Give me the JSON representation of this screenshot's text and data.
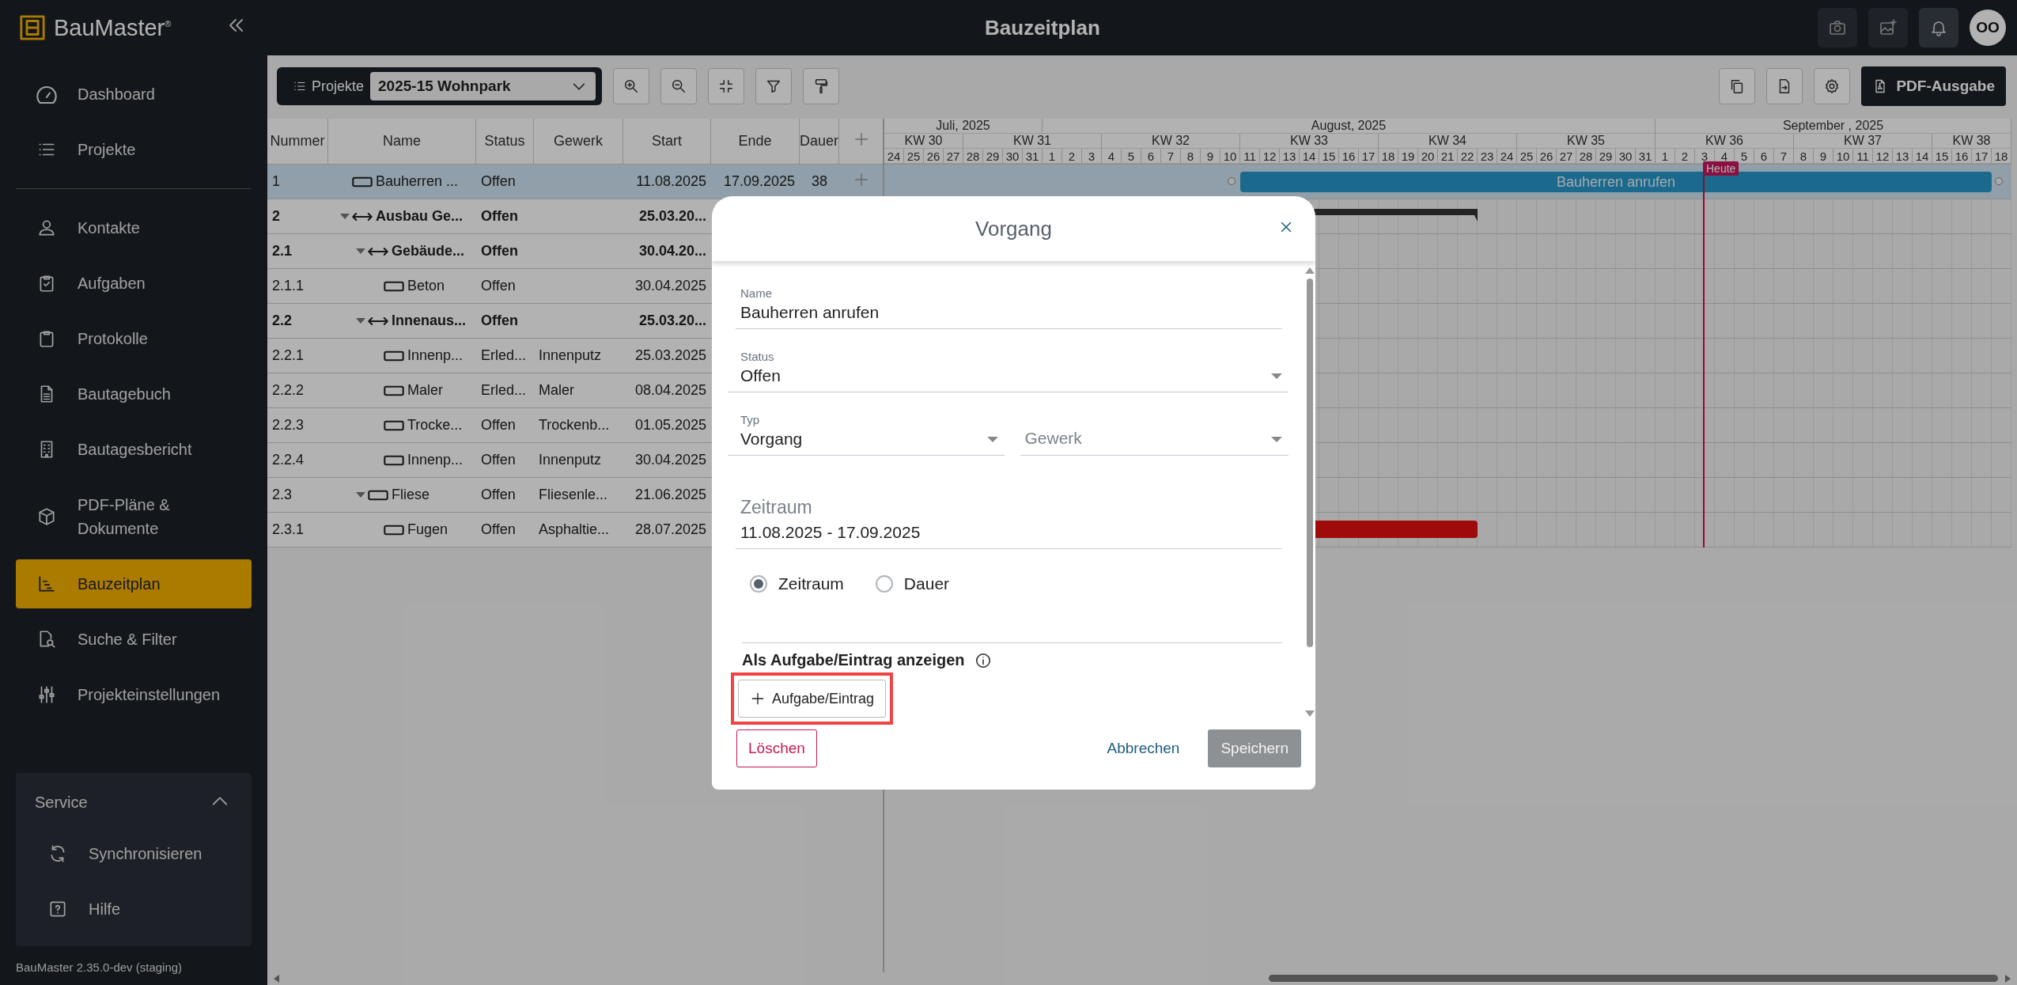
{
  "app": {
    "logo": "BauMaster$^{®}$",
    "version": "BauMaster 2.35.0-dev (staging)"
  },
  "top_bar": {
    "title": "Bauzeitplan",
    "avatar": "OO"
  },
  "sidebar": {
    "sections": [
      {
        "items": [
          {
            "label": "Dashboard",
            "selected": false
          },
          {
            "label": "Projekte",
            "selected": false
          }
        ]
      },
      {
        "items": [
          {
            "label": "Kontakte",
            "selected": false
          },
          {
            "label": "Aufgaben",
            "selected": false
          },
          {
            "label": "Protokolle",
            "selected": false
          },
          {
            "label": "Bautagebuch",
            "selected": false
          },
          {
            "label": "Bautagesbericht",
            "selected": false
          },
          {
            "label": "PDF-Pläne & Dokumente",
            "selected": false
          },
          {
            "label": "Bauzeitplan",
            "selected": true
          },
          {
            "label": "Suche & Filter",
            "selected": false
          },
          {
            "label": "Projekteinstellungen",
            "selected": false
          }
        ]
      }
    ],
    "service": {
      "title": "Service",
      "expanded": true,
      "items": [
        "Synchronisieren",
        "Hilfe"
      ]
    }
  },
  "toolbar": {
    "project_label": "Projekte",
    "project": "2025-15 Wohnpark",
    "export_button": "PDF-Ausgabe"
  },
  "table": {
    "columns": [
      "Nummer",
      "Name",
      "Status",
      "Gewerk",
      "Start",
      "Ende",
      "Dauer"
    ],
    "rows": [
      {
        "number": "1",
        "kind": "task",
        "name": "Bauherren ...",
        "status": "Offen",
        "start": "11.08.2025",
        "end": "17.09.2025",
        "duration": "38",
        "selected": true,
        "bar": {
          "kind": "task",
          "label": "Bauherren anrufen"
        }
      },
      {
        "number": "2",
        "kind": "summary",
        "name": "Ausbau Ge...",
        "status": "Offen",
        "start": "25.03.20...",
        "selected": false,
        "expanded": true,
        "bar": {
          "kind": "summary"
        },
        "children": [
          {
            "number": "2.1",
            "kind": "summary",
            "name": "Gebäude...",
            "status": "Offen",
            "start": "30.04.20...",
            "selected": false,
            "expanded": true,
            "children": [
              {
                "number": "2.1.1",
                "kind": "task",
                "name": "Beton",
                "status": "Offen",
                "start": "30.04.2025",
                "selected": false
              }
            ]
          },
          {
            "number": "2.2",
            "kind": "summary",
            "name": "Innenaus...",
            "status": "Offen",
            "start": "25.03.20...",
            "selected": false,
            "expanded": true,
            "children": [
              {
                "number": "2.2.1",
                "kind": "task",
                "name": "Innenp...",
                "status": "Erled...",
                "trade": "Innenputz",
                "start": "25.03.2025",
                "selected": false
              },
              {
                "number": "2.2.2",
                "kind": "task",
                "name": "Maler",
                "status": "Erled...",
                "trade": "Maler",
                "start": "08.04.2025",
                "selected": false
              },
              {
                "number": "2.2.3",
                "kind": "task",
                "name": "Trocke...",
                "status": "Offen",
                "trade": "Trockenb...",
                "start": "01.05.2025",
                "selected": false
              },
              {
                "number": "2.2.4",
                "kind": "task",
                "name": "Innenp...",
                "status": "Offen",
                "trade": "Innenputz",
                "start": "30.04.2025",
                "selected": false
              }
            ]
          },
          {
            "number": "2.3",
            "kind": "task",
            "name": "Fliese",
            "status": "Offen",
            "trade": "Fliesenle...",
            "start": "21.06.2025",
            "selected": false,
            "expanded": true,
            "children": [
              {
                "number": "2.3.1",
                "kind": "task",
                "name": "Fugen",
                "status": "Offen",
                "trade": "Asphaltie...",
                "start": "28.07.2025",
                "selected": false,
                "bar": {
                  "kind": "critical"
                }
              }
            ]
          }
        ]
      }
    ]
  },
  "gantt": {
    "today_label": "Heute",
    "months": [
      {
        "label": "Juli, 2025",
        "days": [
          "24",
          "25",
          "26",
          "27",
          "28",
          "29",
          "30",
          "31"
        ]
      },
      {
        "label": "August, 2025",
        "days": [
          "1",
          "2",
          "3",
          "4",
          "5",
          "6",
          "7",
          "8",
          "9",
          "10",
          "11",
          "12",
          "13",
          "14",
          "15",
          "16",
          "17",
          "18",
          "19",
          "20",
          "21",
          "22",
          "23",
          "24",
          "25",
          "26",
          "27",
          "28",
          "29",
          "30",
          "31"
        ]
      },
      {
        "label": "September , 2025",
        "days": [
          "1",
          "2",
          "3",
          "4",
          "5",
          "6",
          "7",
          "8",
          "9",
          "10",
          "11",
          "12",
          "13",
          "14",
          "15",
          "16",
          "17",
          "18"
        ]
      }
    ],
    "weeks": [
      "KW 30",
      "KW 31",
      "KW 32",
      "KW 33",
      "KW 34",
      "KW 35",
      "KW 36",
      "KW 37",
      "KW 38"
    ]
  },
  "dialog": {
    "title": "Vorgang",
    "name": {
      "label": "Name",
      "value": "Bauherren anrufen"
    },
    "status": {
      "label": "Status",
      "value": "Offen"
    },
    "type": {
      "label": "Typ",
      "value": "Vorgang"
    },
    "trade": {
      "placeholder": "Gewerk"
    },
    "period": {
      "label": "Zeitraum",
      "value": "11.08.2025 - 17.09.2025"
    },
    "mode_options": [
      {
        "label": "Zeitraum",
        "selected": true
      },
      {
        "label": "Dauer",
        "selected": false
      }
    ],
    "task_section": {
      "heading": "Als Aufgabe/Eintrag anzeigen",
      "button": "Aufgabe/Eintrag",
      "highlighted": true
    },
    "delete_button": "Löschen",
    "cancel_button": "Abbrechen",
    "save_button": {
      "label": "Speichern",
      "disabled": true
    }
  }
}
